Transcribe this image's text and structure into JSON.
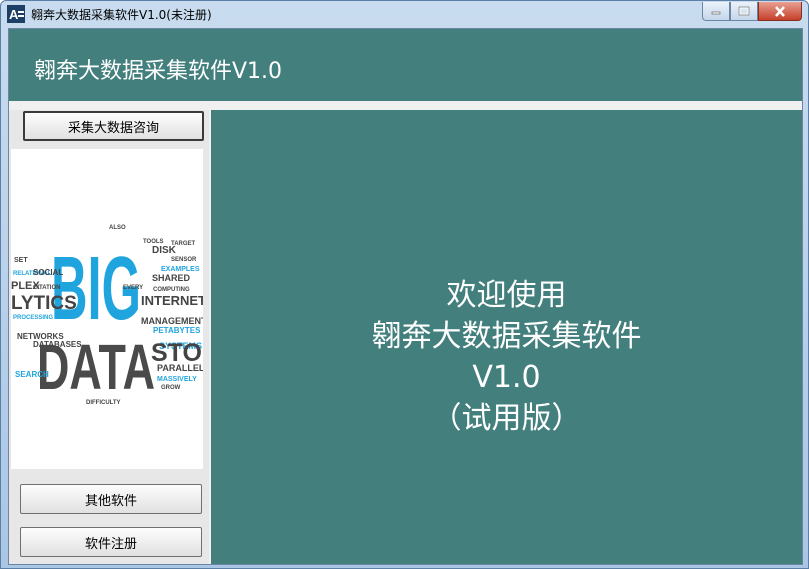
{
  "window": {
    "title": "翱奔大数据采集软件V1.0(未注册)"
  },
  "header": {
    "title": "翱奔大数据采集软件V1.0"
  },
  "sidebar": {
    "consult_button": "采集大数据咨询",
    "other_software_button": "其他软件",
    "register_button": "软件注册"
  },
  "wordcloud": {
    "big": "BIG",
    "data": "DATA",
    "words": [
      "ALSO",
      "TOOLS",
      "TARGET",
      "DISK",
      "EXAMPLES",
      "SENSOR",
      "SET",
      "RELATIONAL",
      "SOCIAL",
      "EVERY",
      "SHARED",
      "COMPUTING",
      "PLEX",
      "CITATION",
      "INTERNET",
      "LYTICS",
      "PROCESSING",
      "MANAGEMENT",
      "PETABYTES",
      "NETWORKS",
      "DATABASES",
      "SYSTEMS",
      "STORAG",
      "SEARCH",
      "PARALLEL",
      "MASSIVELY",
      "GROW",
      "DIFFICULTY"
    ]
  },
  "main": {
    "welcome_line1": "欢迎使用",
    "welcome_line2": "翱奔大数据采集软件",
    "welcome_line3": "V1.0",
    "welcome_line4": "（试用版）"
  },
  "colors": {
    "teal": "#437f7d",
    "wordcloud_blue": "#1fa4de",
    "wordcloud_gray": "#555555"
  }
}
